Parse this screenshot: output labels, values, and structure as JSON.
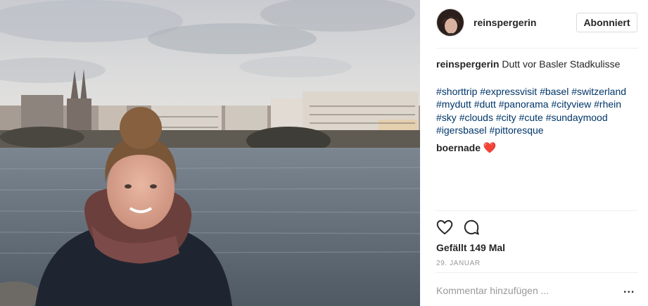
{
  "post": {
    "username": "reinspergerin",
    "follow_label": "Abonniert",
    "caption": {
      "author": "reinspergerin",
      "text": "Dutt vor Basler Stadkulisse"
    },
    "hashtags": [
      "#shorttrip",
      "#expressvisit",
      "#basel",
      "#switzerland",
      "#mydutt",
      "#dutt",
      "#panorama",
      "#cityview",
      "#rhein",
      "#sky",
      "#clouds",
      "#city",
      "#cute",
      "#sundaymood",
      "#igersbasel",
      "#pittoresque"
    ],
    "reply": {
      "author": "boernade",
      "emoji": "❤️"
    },
    "likes_text": "Gefällt 149 Mal",
    "date_text": "29. JANUAR",
    "comment_placeholder": "Kommentar hinzufügen ...",
    "more_label": "..."
  },
  "icons": {
    "like": "heart-outline-icon",
    "comment": "comment-bubble-icon",
    "avatar": "profile-avatar",
    "more": "more-dots-icon"
  },
  "colors": {
    "hashtag": "#003569",
    "text": "#262626",
    "muted": "#999999",
    "border": "#dbdbdb",
    "emoji_heart": "#e0245e"
  }
}
